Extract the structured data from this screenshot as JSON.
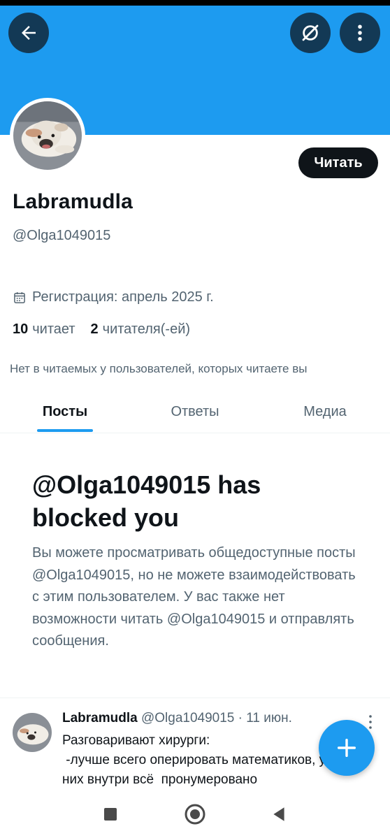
{
  "header": {
    "back_icon": "arrow-left-icon",
    "grok_icon": "grok-icon",
    "more_icon": "more-vertical-icon",
    "banner_color": "#1d9bf0"
  },
  "profile": {
    "follow_label": "Читать",
    "name": "Labramudla",
    "handle": "@Olga1049015",
    "joined": "Регистрация: апрель 2025 г.",
    "following_count": "10",
    "following_label": "читает",
    "followers_count": "2",
    "followers_label": "читателя(-ей)",
    "not_followed_text": "Нет в читаемых у пользователей, которых читаете вы"
  },
  "tabs": [
    {
      "label": "Посты",
      "active": true
    },
    {
      "label": "Ответы",
      "active": false
    },
    {
      "label": "Медиа",
      "active": false
    }
  ],
  "blocked": {
    "title": "@Olga1049015 has blocked you",
    "text": "Вы можете просматривать общедоступные посты @Olga1049015, но не можете взаимодействовать с этим пользователем. У вас также нет возможности читать @Olga1049015 и отправлять сообщения."
  },
  "tweet": {
    "name": "Labramudla",
    "handle_time": "@Olga1049015 · 11 июн.",
    "body": "Разговаривают хирурги:\n -лучше всего оперировать математиков, у\nних внутри всё  пронумеровано"
  },
  "fab_icon": "plus-icon",
  "accent_color": "#1d9bf0"
}
